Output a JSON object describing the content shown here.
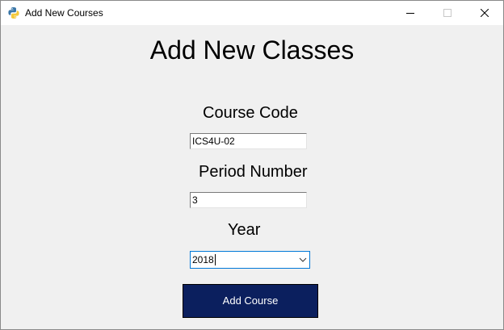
{
  "window": {
    "title": "Add New Courses",
    "app_icon": "python-icon",
    "controls": [
      "minimize-icon",
      "maximize-icon",
      "close-icon"
    ]
  },
  "form": {
    "heading": "Add New Classes",
    "course_code": {
      "label": "Course Code",
      "value": "ICS4U-02"
    },
    "period_number": {
      "label": "Period Number",
      "value": "3"
    },
    "year": {
      "label": "Year",
      "selected": "2018"
    },
    "submit_label": "Add Course"
  },
  "colors": {
    "button_bg": "#0b1f5e",
    "button_text": "#ffffff",
    "focus_border": "#0078d7",
    "window_bg": "#f0f0f0"
  }
}
